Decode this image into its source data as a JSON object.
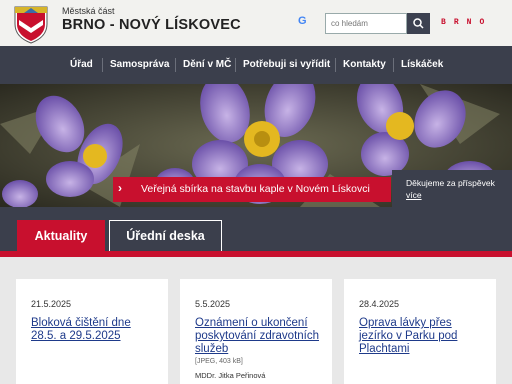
{
  "header": {
    "brand_small": "Městská část",
    "brand_big": "BRNO - NOVÝ LÍSKOVEC",
    "google_label": "G",
    "search_placeholder": "co hledám",
    "brno_letters": [
      "B",
      "R",
      "N",
      "O"
    ]
  },
  "nav": {
    "items": [
      "Úřad",
      "Samospráva",
      "Dění v MČ",
      "Potřebuji si vyřídit",
      "Kontakty",
      "Lískáček"
    ]
  },
  "hero": {
    "banner_text": "Veřejná sbírka na stavbu kaple v Novém Lískovci",
    "note_text": "Děkujeme za příspěvek",
    "note_link": "více"
  },
  "tabs": {
    "active": "Aktuality",
    "other": "Úřední deska"
  },
  "cards": [
    {
      "date": "21.5.2025",
      "title": "Bloková čištění dne 28.5. a 29.5.2025",
      "meta": "",
      "author": ""
    },
    {
      "date": "5.5.2025",
      "title": "Oznámení o ukončení poskytování zdravotních služeb",
      "meta": "[JPEG, 403 kB]",
      "author": "MDDr. Jitka Peřinová"
    },
    {
      "date": "28.4.2025",
      "title": "Oprava lávky přes jezírko v Parku pod Plachtami",
      "meta": "",
      "author": ""
    }
  ],
  "colors": {
    "accent_red": "#c8102e",
    "nav_dark": "#3b3f4c",
    "link_blue": "#1e3a8a"
  }
}
